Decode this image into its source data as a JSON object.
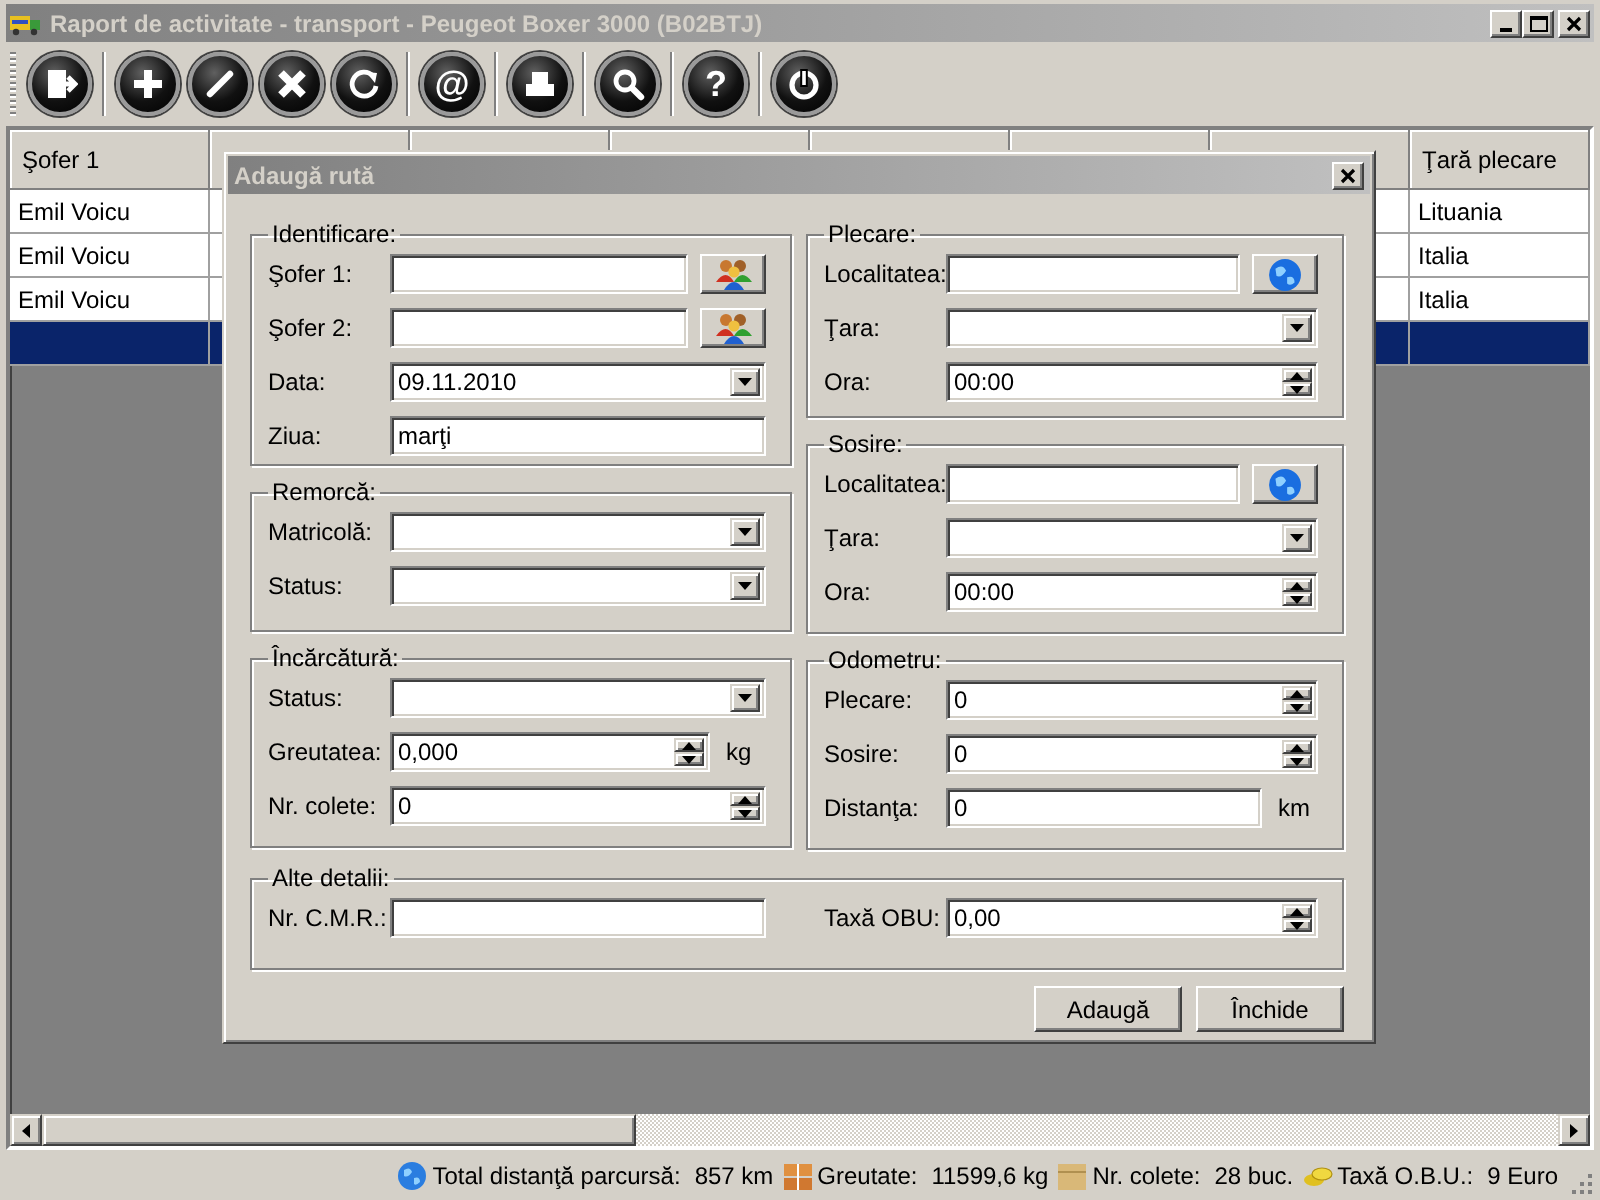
{
  "window": {
    "title": "Raport de activitate - transport - Peugeot Boxer 3000 (B02BTJ)"
  },
  "toolbar_groups": [
    {
      "buttons": [
        {
          "kind": "exit"
        }
      ]
    },
    {
      "buttons": [
        {
          "kind": "add"
        },
        {
          "kind": "edit"
        },
        {
          "kind": "delete"
        },
        {
          "kind": "refresh"
        }
      ]
    },
    {
      "buttons": [
        {
          "kind": "glyph",
          "glyph": "@"
        }
      ]
    },
    {
      "buttons": [
        {
          "kind": "print"
        }
      ]
    },
    {
      "buttons": [
        {
          "kind": "search"
        }
      ]
    },
    {
      "buttons": [
        {
          "kind": "glyph",
          "glyph": "?"
        }
      ]
    },
    {
      "buttons": [
        {
          "kind": "power"
        }
      ]
    }
  ],
  "table": {
    "columns": [
      "Şofer 1",
      "Ţară plecare"
    ],
    "rows": [
      {
        "driver": "Emil Voicu",
        "departure_country": "Lituania",
        "selected": false
      },
      {
        "driver": "Emil Voicu",
        "departure_country": "Italia",
        "selected": false
      },
      {
        "driver": "Emil Voicu",
        "departure_country": "Italia",
        "selected": false
      },
      {
        "selected": true
      }
    ]
  },
  "status_bar": [
    {
      "kind": "distance",
      "label": "Total distanţă parcursă:",
      "value": "857 km"
    },
    {
      "kind": "weight",
      "label": "Greutate:",
      "value": "11599,6 kg"
    },
    {
      "kind": "parcels",
      "label": "Nr. colete:",
      "value": "28 buc."
    },
    {
      "kind": "toll",
      "label": "Taxă O.B.U.:",
      "value": "9 Euro"
    }
  ],
  "dialog": {
    "title": "Adaugă rută",
    "left_groups": [
      {
        "title": "Identificare:",
        "fields": [
          {
            "label": "Şofer 1:",
            "kind": "picker"
          },
          {
            "label": "Şofer 2:",
            "kind": "picker"
          },
          {
            "label": "Data:",
            "kind": "combo",
            "value": "09.11.2010"
          },
          {
            "label": "Ziua:",
            "kind": "text",
            "value": "marţi"
          }
        ]
      },
      {
        "title": "Remorcă:",
        "fields": [
          {
            "label": "Matricolă:",
            "kind": "combo"
          },
          {
            "label": "Status:",
            "kind": "combo"
          }
        ]
      },
      {
        "title": "Încărcătură:",
        "fields": [
          {
            "label": "Status:",
            "kind": "combo"
          },
          {
            "label": "Greutatea:",
            "kind": "spin",
            "value": "0,000",
            "unit": "kg"
          },
          {
            "label": "Nr. colete:",
            "kind": "spin",
            "value": "0"
          }
        ]
      }
    ],
    "right_groups": [
      {
        "title": "Plecare:",
        "fields": [
          {
            "label": "Localitatea:",
            "kind": "locator"
          },
          {
            "label": "Ţara:",
            "kind": "combo"
          },
          {
            "label": "Ora:",
            "kind": "spin",
            "value": "00:00"
          }
        ]
      },
      {
        "title": "Sosire:",
        "fields": [
          {
            "label": "Localitatea:",
            "kind": "locator"
          },
          {
            "label": "Ţara:",
            "kind": "combo"
          },
          {
            "label": "Ora:",
            "kind": "spin",
            "value": "00:00"
          }
        ]
      },
      {
        "title": "Odometru:",
        "fields": [
          {
            "label": "Plecare:",
            "kind": "spin",
            "value": "0"
          },
          {
            "label": "Sosire:",
            "kind": "spin",
            "value": "0"
          },
          {
            "label": "Distanţa:",
            "kind": "text",
            "value": "0",
            "unit": "km"
          }
        ]
      }
    ],
    "bottom_group": {
      "title": "Alte detalii:",
      "fields": [
        {
          "label": "Nr. C.M.R.:",
          "kind": "text"
        },
        {
          "label": "Taxă OBU:",
          "kind": "spin",
          "value": "0,00"
        }
      ]
    },
    "buttons": [
      "Adaugă",
      "Închide"
    ]
  }
}
